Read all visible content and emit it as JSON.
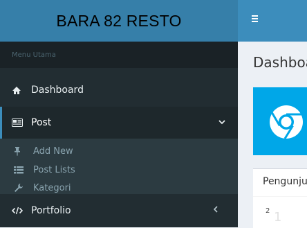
{
  "brand": {
    "name": "BARA 82 RESTO"
  },
  "sidebar": {
    "header": "Menu Utama",
    "items": [
      {
        "label": "Dashboard",
        "icon": "home-icon"
      },
      {
        "label": "Post",
        "icon": "newspaper-icon",
        "active": true,
        "expanded": true
      },
      {
        "label": "Portfolio",
        "icon": "code-icon"
      }
    ],
    "post_submenu": [
      {
        "label": "Add New",
        "icon": "pushpin-icon"
      },
      {
        "label": "Post Lists",
        "icon": "list-icon"
      },
      {
        "label": "Kategori",
        "icon": "wrench-icon"
      }
    ]
  },
  "topbar": {
    "toggle_icon": "hamburger-icon"
  },
  "content": {
    "title": "Dashboard",
    "card_icon": "chrome-icon",
    "panel_title": "Pengunjung",
    "panel_number": "2",
    "panel_faint": "1"
  },
  "colors": {
    "sidebar_bg": "#222d32",
    "brand_bg": "#367fa9",
    "topbar_bg": "#3c8dbc",
    "accent": "#00a7e8"
  }
}
